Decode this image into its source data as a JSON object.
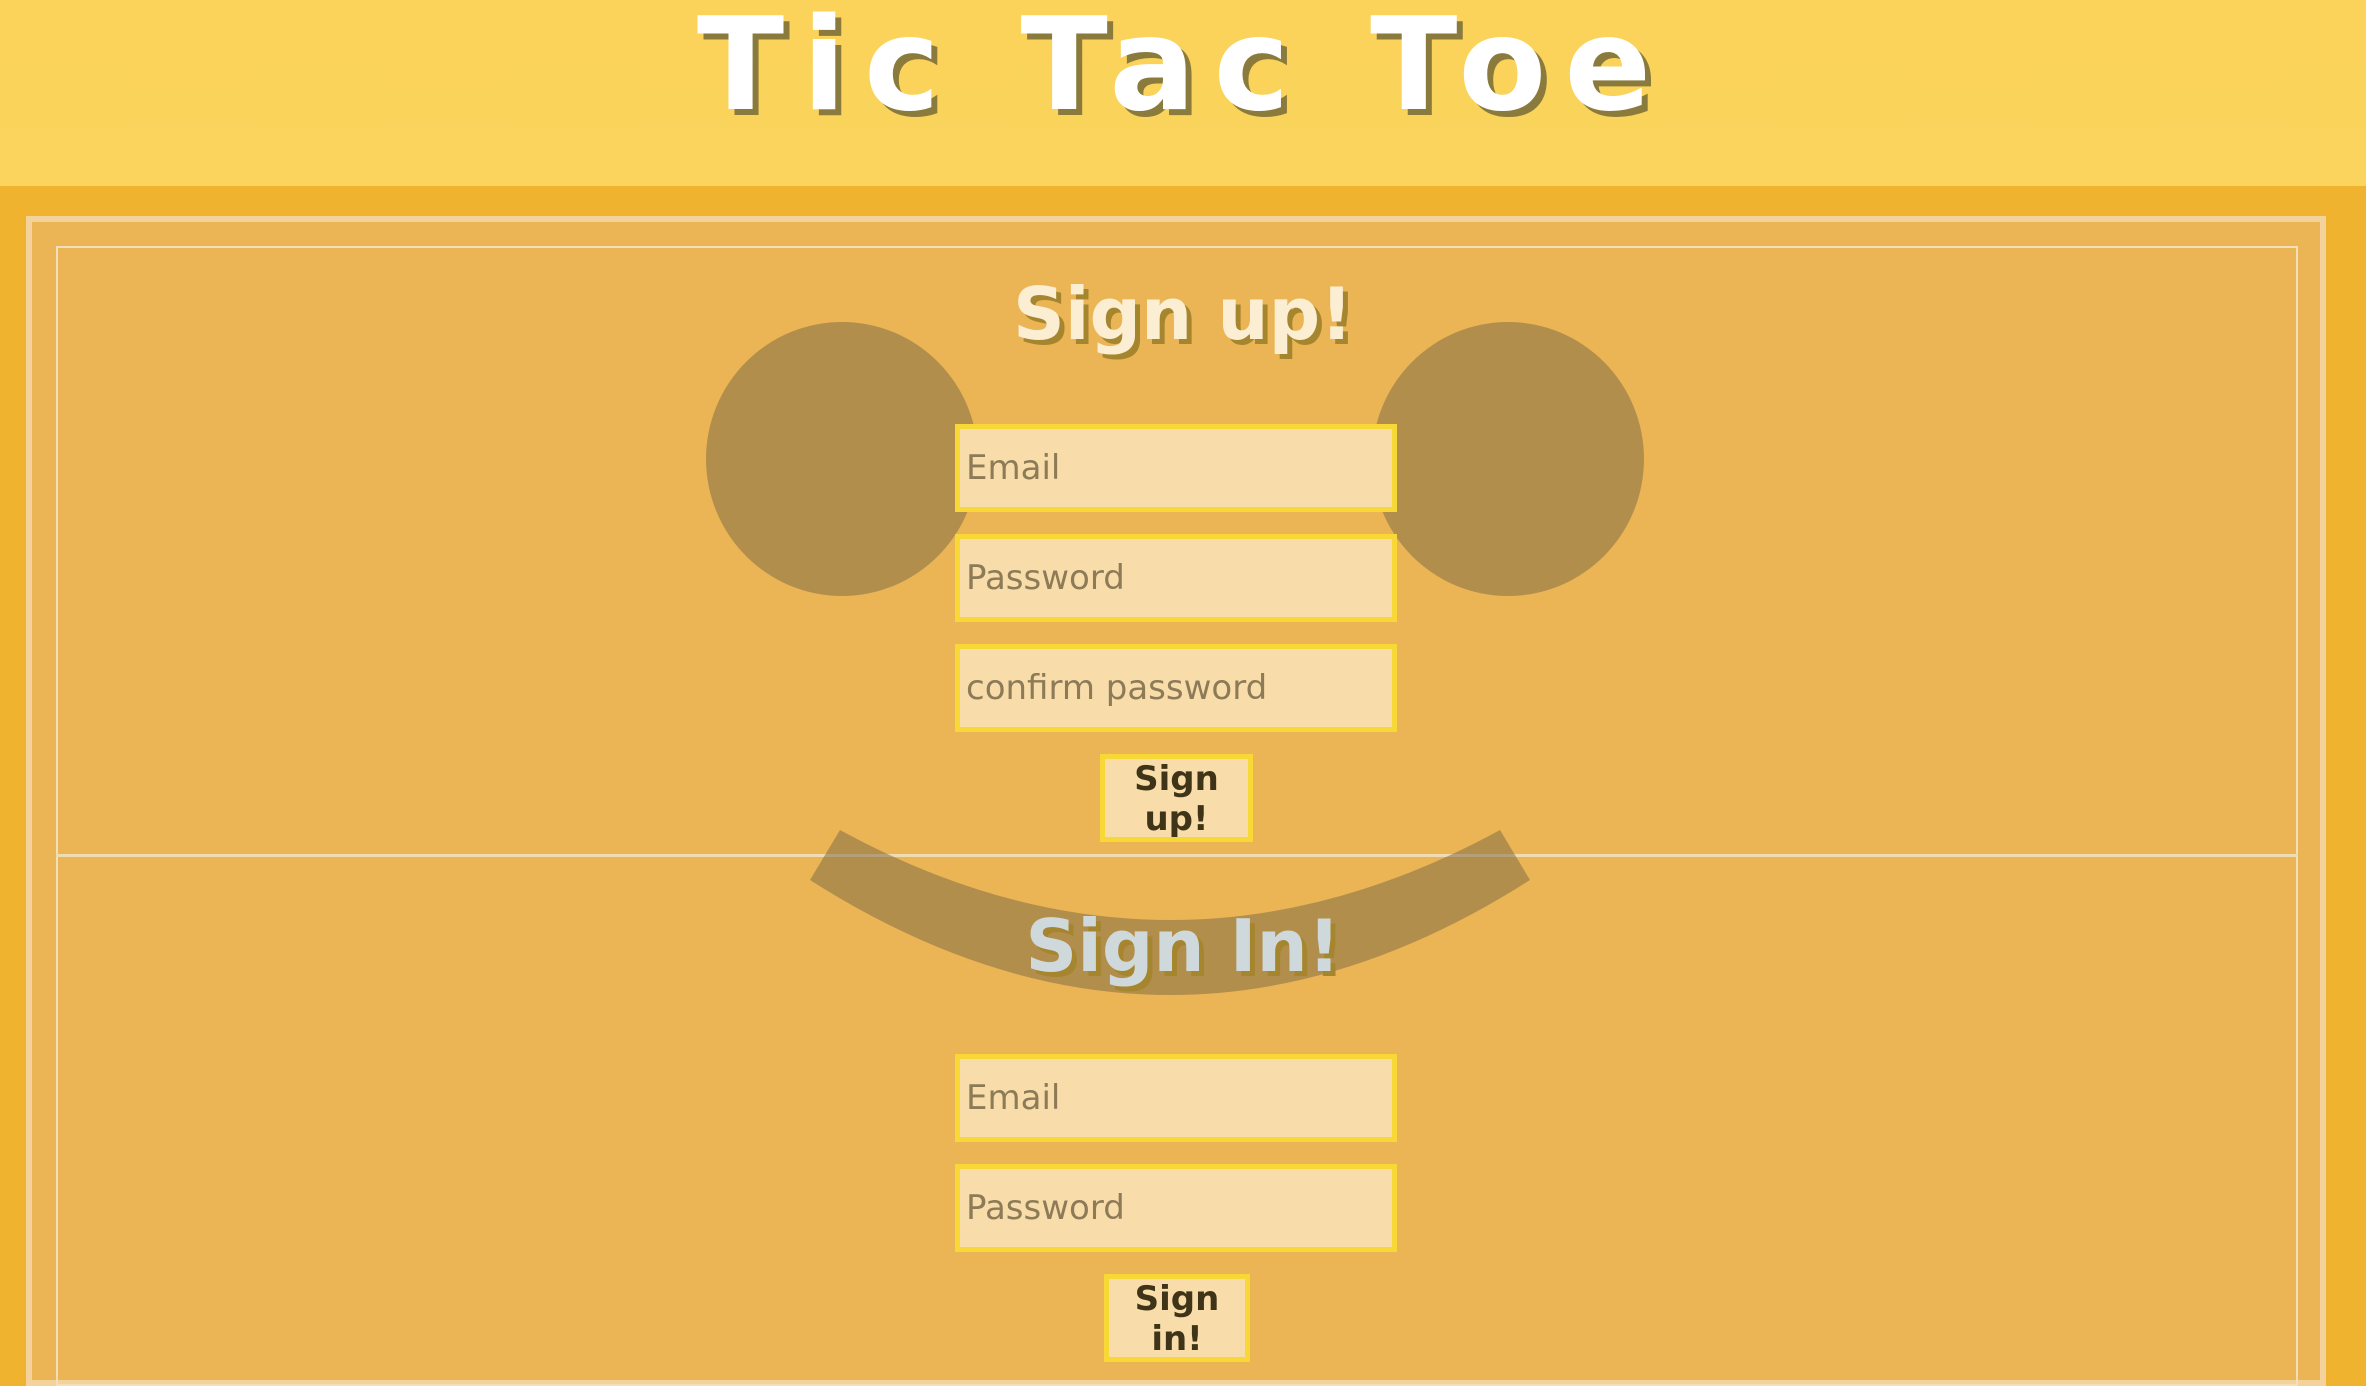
{
  "header": {
    "title": "Tic Tac Toe"
  },
  "sign_up": {
    "title": "Sign up!",
    "email_placeholder": "Email",
    "password_placeholder": "Password",
    "confirm_placeholder": "confirm password",
    "button_label": "Sign up!"
  },
  "sign_in": {
    "title": "Sign In!",
    "email_placeholder": "Email",
    "password_placeholder": "Password",
    "button_label": "Sign in!"
  },
  "colors": {
    "header_bg": "#fbd25a",
    "page_bg": "#f0b32f",
    "panel_bg": "#ebb556",
    "input_bg": "#f8ddaa",
    "input_border": "#f7d836",
    "smiley": "#846e46"
  },
  "decorations": {
    "background_icon": "smiley-face-icon"
  }
}
